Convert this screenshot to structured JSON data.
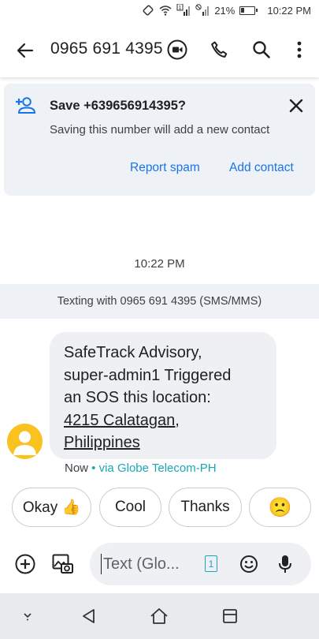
{
  "status_bar": {
    "battery": "21%",
    "time": "10:22 PM",
    "sim_indicator": "1"
  },
  "app_bar": {
    "contact": "0965 691 4395",
    "icons": [
      "back-arrow-icon",
      "video-call-icon",
      "phone-icon",
      "search-icon",
      "more-vert-icon"
    ]
  },
  "save_card": {
    "title": "Save +639656914395?",
    "subtitle": "Saving this number will add a new contact",
    "report_spam": "Report spam",
    "add_contact": "Add contact"
  },
  "conversation": {
    "timestamp": "10:22 PM",
    "banner": "Texting with 0965 691 4395 (SMS/MMS)",
    "message": {
      "lines": [
        "SafeTrack Advisory,",
        "super-admin1 Triggered",
        "an SOS this location:"
      ],
      "address_lines": [
        "4215 Calatagan,",
        "Philippines"
      ],
      "time": "Now",
      "via": " • via Globe Telecom-PH"
    }
  },
  "smart_replies": [
    "Okay 👍",
    "Cool",
    "Thanks",
    "🙁"
  ],
  "compose": {
    "placeholder": "Text (Glo...",
    "sim_badge": "1"
  },
  "colors": {
    "accent": "#1a73e8",
    "carrier": "#1aa7b8",
    "avatar": "#f9c21e",
    "card_bg": "#eef2f7"
  }
}
